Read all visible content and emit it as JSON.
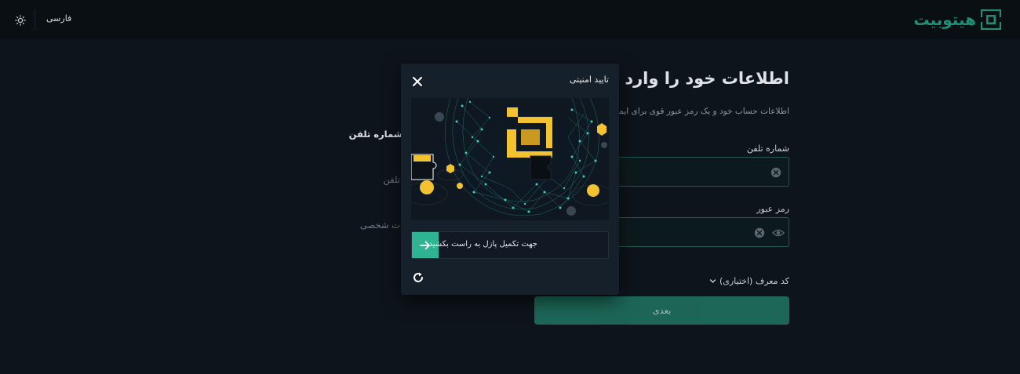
{
  "topbar": {
    "language": "فارسی",
    "theme_icon": "sun-icon",
    "logo_text": "هیتوبیت",
    "logo_icon": "hitobit-logo-icon"
  },
  "login": {
    "title": "اطلاعات خود را وارد کنید",
    "subtitle": "اطلاعات حساب خود و یک رمز عبور قوی برای ایمن سازی",
    "phone_label": "شماره تلفن",
    "phone_value": "",
    "password_label": "رمز عبور",
    "password_value": "",
    "referral_label": "کد معرف (اختیاری)",
    "next_button": "بعدی"
  },
  "steps": [
    {
      "label": "شماره تلفن",
      "active": true
    },
    {
      "label": "تلفن",
      "active": false
    },
    {
      "label": "ت شخصی",
      "active": false
    }
  ],
  "captcha": {
    "title": "تایید امنیتی",
    "slider_text": "جهت تکمیل پازل به راست بکشید",
    "icons": [
      "close-icon",
      "arrow-right-icon",
      "refresh-icon"
    ]
  },
  "colors": {
    "accent": "#2eb393",
    "brand": "#1f8f74",
    "background": "#0e141b",
    "modal": "#15202b",
    "button": "#1e6b5b"
  }
}
